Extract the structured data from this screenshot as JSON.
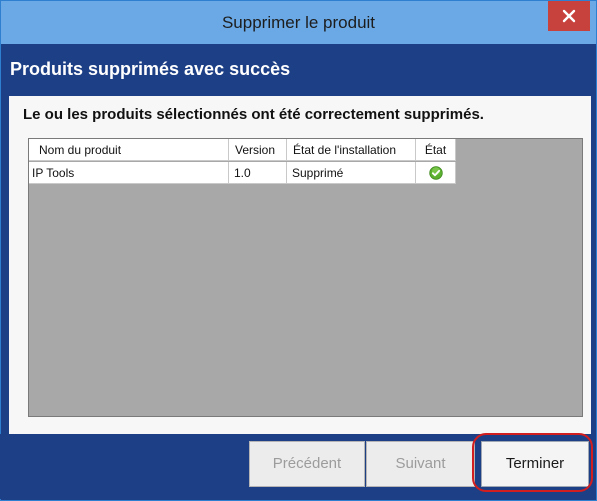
{
  "window": {
    "title": "Supprimer le produit",
    "close_icon": "close-icon"
  },
  "header": {
    "title": "Produits supprimés avec succès"
  },
  "content": {
    "message": "Le ou les produits sélectionnés ont été correctement supprimés."
  },
  "table": {
    "columns": [
      "Nom du produit",
      "Version",
      "État de l'installation",
      "État"
    ],
    "rows": [
      {
        "name": "IP Tools",
        "version": "1.0",
        "install_state": "Supprimé",
        "status_icon": "check-circle-icon"
      }
    ]
  },
  "buttons": {
    "previous": "Précédent",
    "next": "Suivant",
    "finish": "Terminer"
  },
  "colors": {
    "titlebar": "#6aa9e6",
    "band": "#1d3f86",
    "close": "#c7413d",
    "highlight": "#d21e1e",
    "success_icon": "#5cb030"
  }
}
